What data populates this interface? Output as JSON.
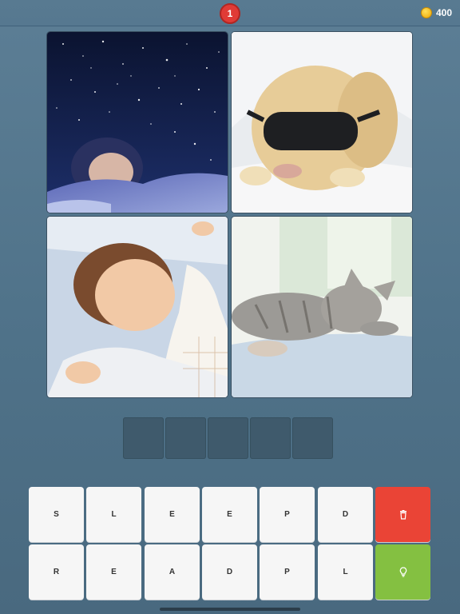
{
  "header": {
    "level": "1",
    "coins": "400"
  },
  "pictures": [
    {
      "subject": "child sleeping under starry night sky"
    },
    {
      "subject": "dog sleeping with eye mask"
    },
    {
      "subject": "baby sleeping"
    },
    {
      "subject": "kitten sleeping"
    }
  ],
  "answer": {
    "slots": [
      "",
      "",
      "",
      "",
      ""
    ]
  },
  "keyboard": {
    "row1": [
      "S",
      "L",
      "E",
      "E",
      "P",
      "D"
    ],
    "row2": [
      "R",
      "E",
      "A",
      "D",
      "P",
      "L"
    ]
  },
  "icons": {
    "delete": "trash-icon",
    "hint": "lightbulb-icon",
    "coin": "coin-icon"
  },
  "colors": {
    "delete": "#ea4436",
    "hint": "#84c041",
    "level_badge": "#e03b36",
    "coin": "#f2b81c"
  }
}
